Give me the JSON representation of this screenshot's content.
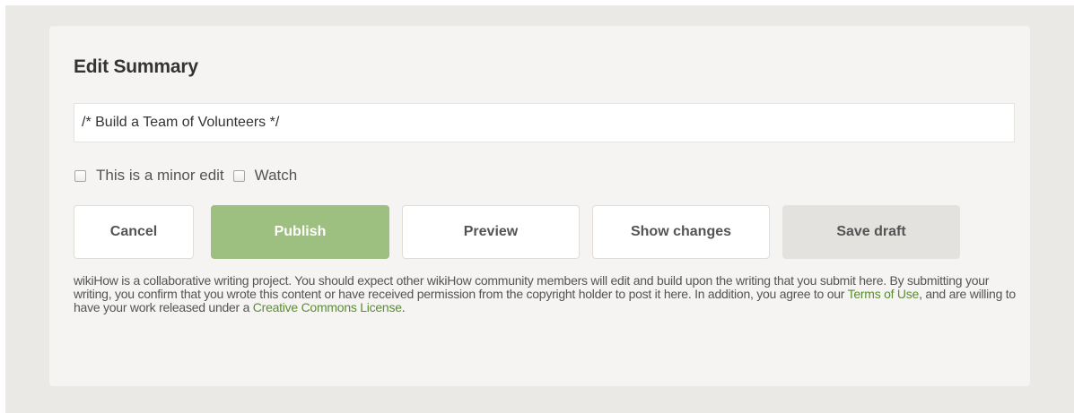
{
  "edit_summary": {
    "title": "Edit Summary",
    "input_value": "/* Build a Team of Volunteers */"
  },
  "options": {
    "minor_edit_label": "This is a minor edit",
    "minor_edit_checked": false,
    "watch_label": "Watch",
    "watch_checked": false
  },
  "buttons": {
    "cancel": "Cancel",
    "publish": "Publish",
    "preview": "Preview",
    "show_changes": "Show changes",
    "save_draft": "Save draft"
  },
  "disclaimer": {
    "text_part1": "wikiHow is a collaborative writing project. You should expect other wikiHow community members will edit and build upon the writing that you submit here. By submitting your writing, you confirm that you wrote this content or have received permission from the copyright holder to post it here. In addition, you agree to our ",
    "terms_link": "Terms of Use",
    "text_part2": ", and are willing to have your work released under a ",
    "cc_link": "Creative Commons License",
    "text_part3": "."
  },
  "colors": {
    "publish_bg": "#9dbf7f",
    "link": "#5b8c33",
    "panel_bg": "#f5f4f2",
    "outer_bg": "#ebe9e5"
  }
}
